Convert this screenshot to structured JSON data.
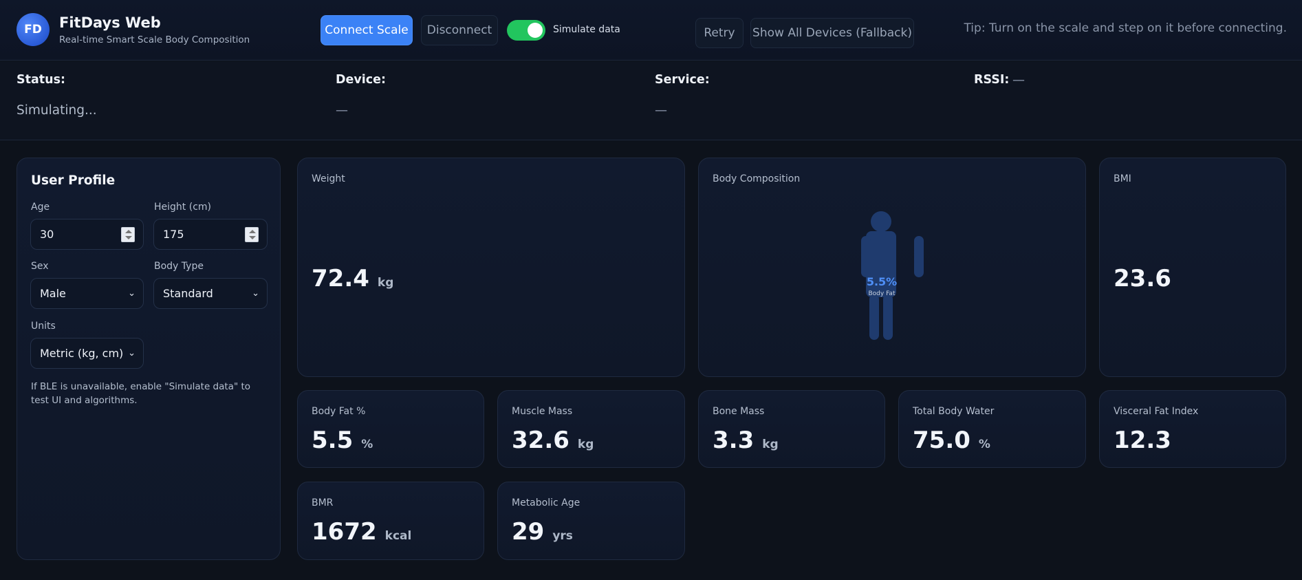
{
  "header": {
    "logo_text": "FD",
    "title": "FitDays Web",
    "subtitle": "Real-time Smart Scale Body Composition",
    "connect_label": "Connect Scale",
    "disconnect_label": "Disconnect",
    "simulate_label": "Simulate data",
    "simulate_on": true,
    "retry_label": "Retry",
    "fallback_label": "Show All Devices (Fallback)",
    "tip": "Tip: Turn on the scale and step on it before connecting."
  },
  "status": {
    "status_label": "Status:",
    "status_value": "Simulating...",
    "device_label": "Device:",
    "device_value": "—",
    "service_label": "Service:",
    "service_value": "—",
    "rssi_label": "RSSI:",
    "rssi_value": "—"
  },
  "profile": {
    "title": "User Profile",
    "age_label": "Age",
    "age_value": "30",
    "height_label": "Height (cm)",
    "height_value": "175",
    "sex_label": "Sex",
    "sex_value": "Male",
    "body_type_label": "Body Type",
    "body_type_value": "Standard",
    "units_label": "Units",
    "units_value": "Metric (kg, cm)",
    "note": "If BLE is unavailable, enable \"Simulate data\" to test UI and algorithms."
  },
  "metrics": {
    "weight": {
      "label": "Weight",
      "value": "72.4",
      "unit": "kg"
    },
    "composition": {
      "label": "Body Composition",
      "bodyfat_value": "5.5%",
      "bodyfat_label": "Body Fat"
    },
    "bmi": {
      "label": "BMI",
      "value": "23.6"
    },
    "body_fat": {
      "label": "Body Fat %",
      "value": "5.5",
      "unit": "%"
    },
    "muscle": {
      "label": "Muscle Mass",
      "value": "32.6",
      "unit": "kg"
    },
    "bone": {
      "label": "Bone Mass",
      "value": "3.3",
      "unit": "kg"
    },
    "water": {
      "label": "Total Body Water",
      "value": "75.0",
      "unit": "%"
    },
    "visceral": {
      "label": "Visceral Fat Index",
      "value": "12.3"
    },
    "bmr": {
      "label": "BMR",
      "value": "1672",
      "unit": "kcal"
    },
    "metabolic_age": {
      "label": "Metabolic Age",
      "value": "29",
      "unit": "yrs"
    }
  },
  "colors": {
    "accent": "#3b82f6",
    "toggle_on": "#22c55e",
    "background": "#0d121b"
  }
}
